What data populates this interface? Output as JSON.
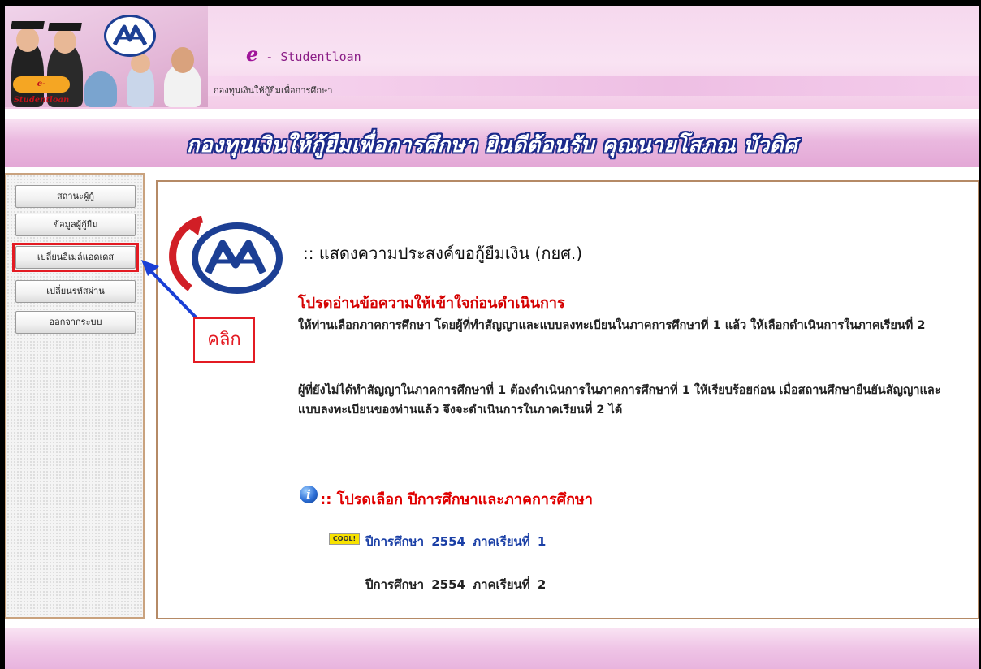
{
  "header": {
    "brand_prefix": "e",
    "brand_name": " - Studentloan",
    "subtitle": "กองทุนเงินให้กู้ยืมเพื่อการศึกษา",
    "badge": "e-Studentloan"
  },
  "welcome": {
    "text": "กองทุนเงินให้กู้ยืมเพื่อการศึกษา ยินดีต้อนรับ คุณนายโสภณ บัวดิศ"
  },
  "sidebar": {
    "items": [
      {
        "label": "สถานะผู้กู้"
      },
      {
        "label": "ข้อมูลผู้กู้ยืม"
      },
      {
        "label": "เปลี่ยนอีเมล์แอดเดส"
      },
      {
        "label": "เปลี่ยนรหัสผ่าน"
      },
      {
        "label": "ออกจากระบบ"
      }
    ],
    "highlighted_index": 2
  },
  "annotation": {
    "label": "คลิก",
    "color": "#e31b23"
  },
  "main": {
    "title": ":: แสดงความประสงค์ขอกู้ยืมเงิน (กยศ.)",
    "notice_heading": "โปรดอ่านข้อความให้เข้าใจก่อนดำเนินการ",
    "paragraph1": "ให้ท่านเลือกภาคการศึกษา โดยผู้ที่ทำสัญญาและแบบลงทะเบียนในภาคการศึกษาที่ 1 แล้ว ให้เลือกดำเนินการในภาคเรียนที่ 2",
    "paragraph2": "ผู้ที่ยังไม่ได้ทำสัญญาในภาคการศึกษาที่ 1 ต้องดำเนินการในภาคการศึกษาที่ 1 ให้เรียบร้อยก่อน เมื่อสถานศึกษายืนยันสัญญาและแบบลงทะเบียนของท่านแล้ว จึงจะดำเนินการในภาคเรียนที่ 2 ได้",
    "select_heading": ":: โปรดเลือก ปีการศึกษาและภาคการศึกษา",
    "info_icon": "i",
    "cool_badge": "COOL!",
    "terms": [
      {
        "label": "ปีการศึกษา  2554  ภาคเรียนที่  1"
      },
      {
        "label": "ปีการศึกษา  2554  ภาคเรียนที่  2"
      }
    ]
  },
  "colors": {
    "accent_red": "#e31b23",
    "link_blue": "#1a3fa6",
    "header_pink": "#f3cbe7",
    "welcome_outline": "#1b2a8a"
  }
}
